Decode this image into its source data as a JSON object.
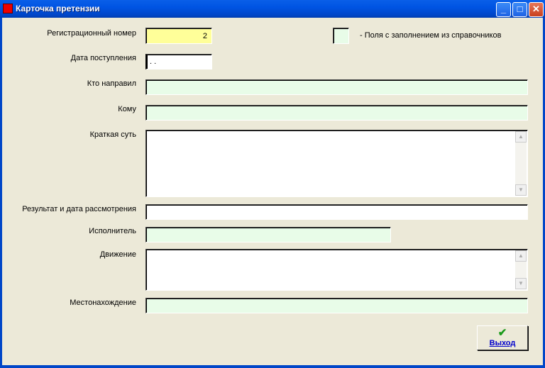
{
  "window": {
    "title": "Карточка претензии",
    "minimize": "_",
    "maximize": "□",
    "close": "✕"
  },
  "legend": {
    "text": "-  Поля с заполнением из справочников"
  },
  "fields": {
    "reg_number": {
      "label": "Регистрационный номер",
      "value": "2"
    },
    "date_received": {
      "label": "Дата поступления",
      "value": " . ."
    },
    "sender": {
      "label": "Кто направил",
      "value": ""
    },
    "recipient": {
      "label": "Кому",
      "value": ""
    },
    "summary": {
      "label": "Краткая суть",
      "value": ""
    },
    "result": {
      "label": "Результат и дата рассмотрения",
      "value": ""
    },
    "executor": {
      "label": "Исполнитель",
      "value": ""
    },
    "movement": {
      "label": "Движение",
      "value": ""
    },
    "location": {
      "label": "Местонахождение",
      "value": ""
    }
  },
  "exit_button": {
    "label": "Выход",
    "icon": "checkmark-icon"
  },
  "colors": {
    "lookup_field": "#E8FCE8",
    "key_field": "#FFFF99"
  }
}
